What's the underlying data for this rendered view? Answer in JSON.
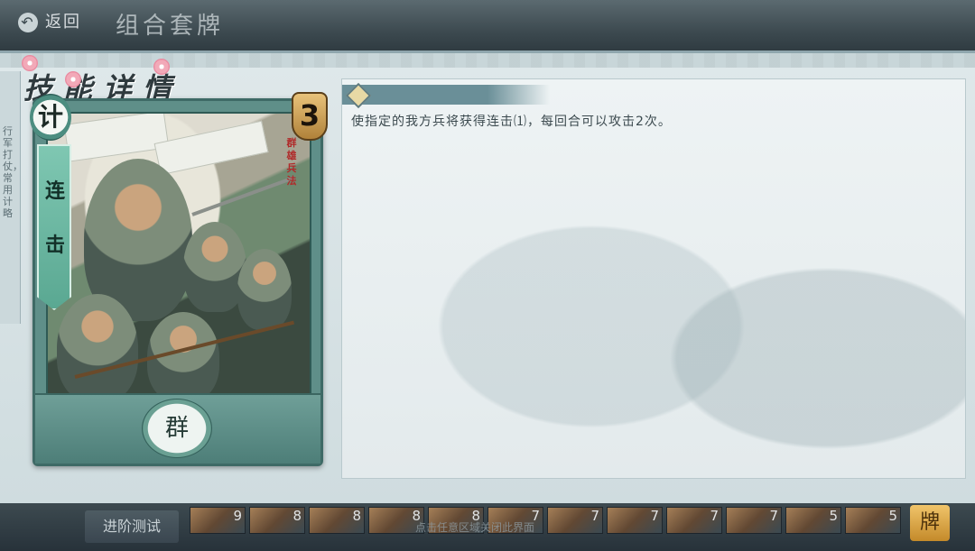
{
  "header": {
    "back_label": "返回",
    "title": "组合套牌"
  },
  "side": {
    "text": "行军打仗，常用计略"
  },
  "skill_title": "技能详情",
  "card": {
    "type_glyph": "计",
    "name": "连击",
    "cost": "3",
    "tag": "群雄兵法",
    "faction": "群"
  },
  "description": "使指定的我方兵将获得连击⑴，每回合可以攻击2次。",
  "bottom": {
    "advance_label": "进阶测试",
    "close_hint": "点击任意区域关闭此界面",
    "right_button": "牌",
    "mini_card_numbers": [
      "9",
      "8",
      "8",
      "8",
      "8",
      "7",
      "7",
      "7",
      "7",
      "7",
      "5",
      "5"
    ]
  },
  "colors": {
    "accent": "#6a8f98",
    "cost_gold": "#e8c27a",
    "ribbon": "#7fc7b2"
  }
}
